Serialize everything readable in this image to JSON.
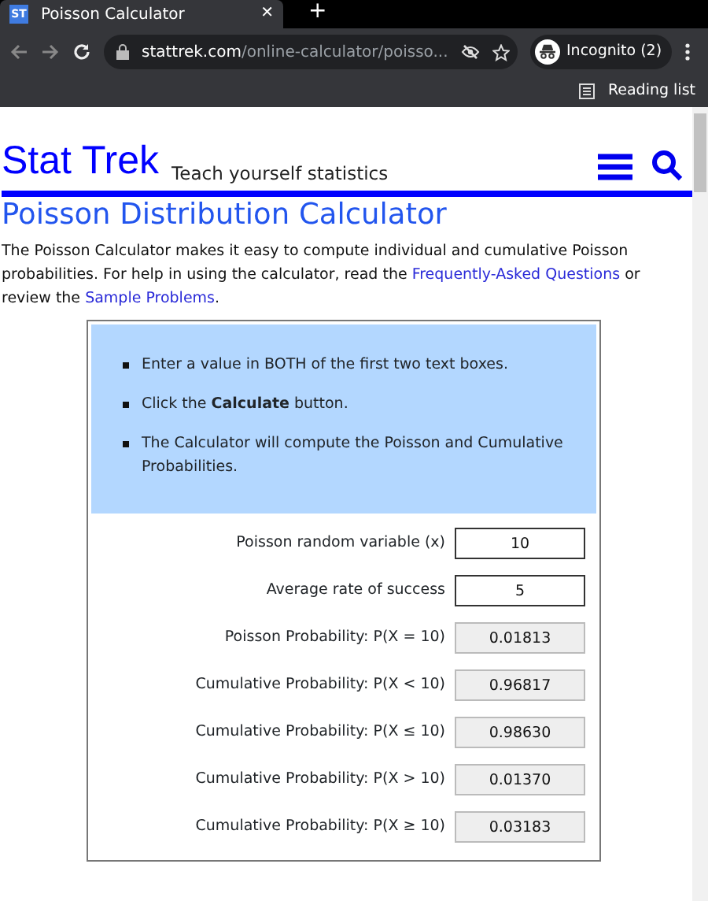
{
  "browser": {
    "tab": {
      "title": "Poisson Calculator",
      "favicon": "ST",
      "close": "✕"
    },
    "new_tab": "+",
    "address": {
      "domain": "stattrek.com",
      "path": "/online-calculator/poisso..."
    },
    "profile": "Incognito (2)",
    "reading_list": "Reading list"
  },
  "site": {
    "logo": "Stat Trek",
    "tagline": "Teach yourself statistics"
  },
  "page": {
    "title": "Poisson Distribution Calculator",
    "intro": [
      {
        "text": "The Poisson Calculator makes it easy to compute individual and cumulative Poisson probabilities. For help in using the calculator, read the ",
        "kind": "text"
      },
      {
        "text": "Frequently-Asked Questions",
        "kind": "link"
      },
      {
        "text": " or review the ",
        "kind": "text"
      },
      {
        "text": "Sample Problems",
        "kind": "link"
      },
      {
        "text": ".",
        "kind": "text"
      }
    ]
  },
  "instructions": [
    "Enter a value in BOTH of the first two text boxes.",
    "Click the **Calculate** button.",
    "The Calculator will compute the Poisson and Cumulative Probabilities."
  ],
  "fields": [
    {
      "label": "Poisson random variable (x)",
      "value": "10",
      "kind": "input"
    },
    {
      "label": "Average rate of success",
      "value": "5",
      "kind": "input"
    },
    {
      "label": "Poisson Probability: P(X = 10)",
      "value": "0.01813",
      "kind": "output"
    },
    {
      "label": "Cumulative Probability: P(X < 10)",
      "value": "0.96817",
      "kind": "output"
    },
    {
      "label": "Cumulative Probability: P(X ≤ 10)",
      "value": "0.98630",
      "kind": "output"
    },
    {
      "label": "Cumulative Probability: P(X > 10)",
      "value": "0.01370",
      "kind": "output"
    },
    {
      "label": "Cumulative Probability: P(X ≥ 10)",
      "value": "0.03183",
      "kind": "output"
    }
  ]
}
